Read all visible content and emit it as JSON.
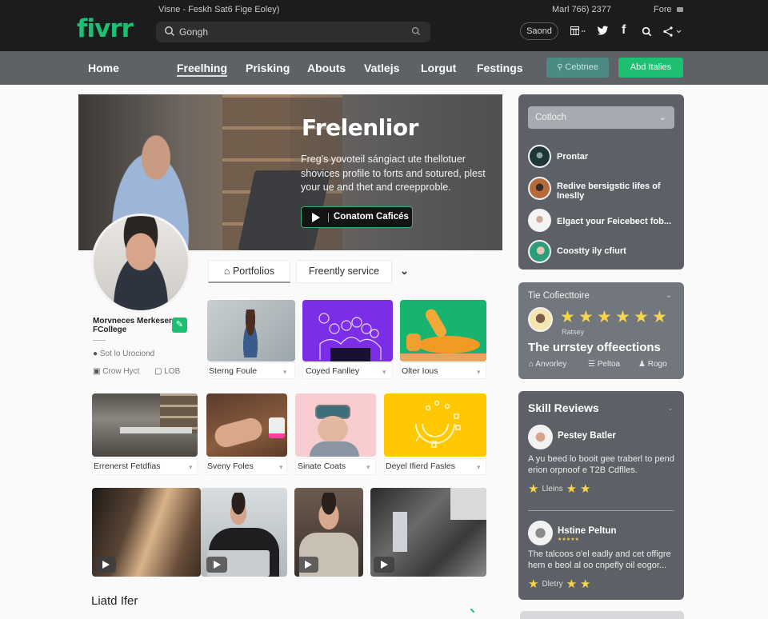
{
  "topbar": {
    "logo": "fivrr",
    "window_title": "Visne - Feskh Sat6 Fige Eoley)",
    "search_value": "Gongh",
    "date_text": "Marl 766) 2377",
    "fore_label": "Fore",
    "save_label": "Saond",
    "icons": [
      "calendar-icon",
      "twitter-icon",
      "facebook-icon",
      "search-icon",
      "share-icon"
    ]
  },
  "nav": {
    "items": [
      {
        "label": "Home",
        "active": false
      },
      {
        "label": "Freelhing",
        "active": true
      },
      {
        "label": "Prisking",
        "active": false
      },
      {
        "label": "Abouts",
        "active": false
      },
      {
        "label": "Vatlejs",
        "active": false
      },
      {
        "label": "Lorgut",
        "active": false
      },
      {
        "label": "Festings",
        "active": false
      }
    ],
    "secondary_button": "Cebtnee",
    "primary_button": "Abd Italies"
  },
  "hero": {
    "title": "Frelenlior",
    "description": "Freg's yovoteil sángiact ute thellotuer shovices profile to forts and sotured, plest your ue and thet and creepproble.",
    "cta_label": "Conatom Caficés"
  },
  "profile": {
    "name": "Morvneces Merkeser FCollege",
    "location": "Sot lo Urociond",
    "meta_1": "Crow Hyct",
    "meta_2": "LOB"
  },
  "tabs": [
    {
      "label": "Portfolios",
      "active": true
    },
    {
      "label": "Freently service",
      "active": false
    }
  ],
  "tab_extra": "⌄",
  "portfolio_row_1": [
    {
      "label": "Sterng Foule"
    },
    {
      "label": "Coyed Fanlley"
    },
    {
      "label": "Olter Ious"
    }
  ],
  "portfolio_row_2": [
    {
      "label": "Errenerst Fetdfias"
    },
    {
      "label": "Sveny Foles"
    },
    {
      "label": "Sinate Coats"
    },
    {
      "label": "Deyel Ifierd Fasles"
    }
  ],
  "videos": [
    {
      "name": "video-1"
    },
    {
      "name": "video-2"
    },
    {
      "name": "video-3"
    },
    {
      "name": "video-4"
    }
  ],
  "bottom_title": "Liatd Ifer",
  "sidebar": {
    "select_value": "Cotloch",
    "items": [
      {
        "text": "Prontar"
      },
      {
        "text": "Redive bersigstic lifes of Ineslly"
      },
      {
        "text": "Elgact your Feicebect fob..."
      },
      {
        "text": "Coostty ily cfiurt"
      }
    ],
    "collection": {
      "title": "Tie Cofiecttoire",
      "rating": 6,
      "rating_label": "Ratsey",
      "headline": "The urrstey offeections",
      "links": [
        "Anvorley",
        "Peltoa",
        "Rogo"
      ]
    },
    "skill_reviews": {
      "title": "Skill Reviews",
      "reviews": [
        {
          "name": "Pestey Batler",
          "text": "A yu beed lo booit gee traberl to pend erion orpnoof e T2B Cdflles.",
          "tag": "Lleins",
          "stars_after": 2
        },
        {
          "name": "Hstine Peltun",
          "subtitle": "★★★★★",
          "text": "The talcoos o'el eadly and cet offigre hem e beol al oo cnpefly oil eogor...",
          "tag": "Dletry",
          "stars_after": 2
        }
      ]
    }
  },
  "colors": {
    "brand_green": "#1dbf73",
    "topbar_bg": "#1b1c1d",
    "navbar_bg": "#5e6267",
    "sidebar_bg": "#5d6167",
    "star": "#f6d548"
  }
}
